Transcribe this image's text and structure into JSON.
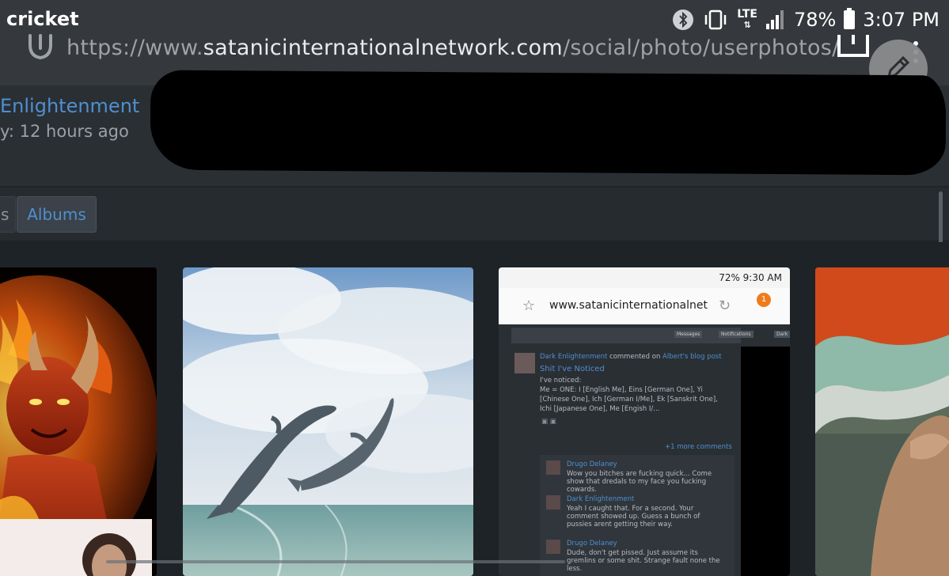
{
  "status_bar": {
    "carrier": "cricket",
    "network": "LTE",
    "battery": "78%",
    "time": "3:07 PM"
  },
  "url_bar": {
    "url_scheme": "https://www.",
    "url_domain": "satanicinternationalnetwork.com",
    "url_path": "/social/photo/userphotos/"
  },
  "profile": {
    "name": "Enlightenment",
    "meta": "y: 12 hours ago"
  },
  "nav": {
    "prev_tab_fragment": "s",
    "active_tab": "Albums"
  },
  "screenshot_tile": {
    "status": "72% 9:30 AM",
    "url": "www.satanicinternationalnet",
    "badge": "1",
    "header_buttons": [
      "Messages",
      "Notifications",
      "Dark"
    ],
    "post_author": "Dark Enlightenment",
    "post_action": "commented on",
    "post_target": "Albert's blog post",
    "post_title": "Shit I've Noticed",
    "post_body_1": "I've noticed:",
    "post_body_2": "Me = ONE: I [English Me], Eins [German One], Yi",
    "post_body_3": "[Chinese One], Ich [German I/Me], Ek [Sanskrit One],",
    "post_body_4": "Ichi [Japanese One], Me [Engish I/...",
    "more_comments": "+1 more comments",
    "comments": [
      {
        "author": "Drugo Delaney",
        "text": "Wow you bitches are fucking quick... Come show that dredals to my face you fucking cowards."
      },
      {
        "author": "Dark Enlightenment",
        "text": "Yeah I caught that. For a second. Your comment showed up. Guess a bunch of pussies arent getting their way."
      },
      {
        "author": "Drugo Delaney",
        "text": "Dude, don't get pissed. Just assume its gremlins or some shit. Strange fault none the less."
      }
    ]
  },
  "colors": {
    "accent": "#4f8fcf",
    "background": "#1f2429",
    "topbar": "#35383c"
  }
}
